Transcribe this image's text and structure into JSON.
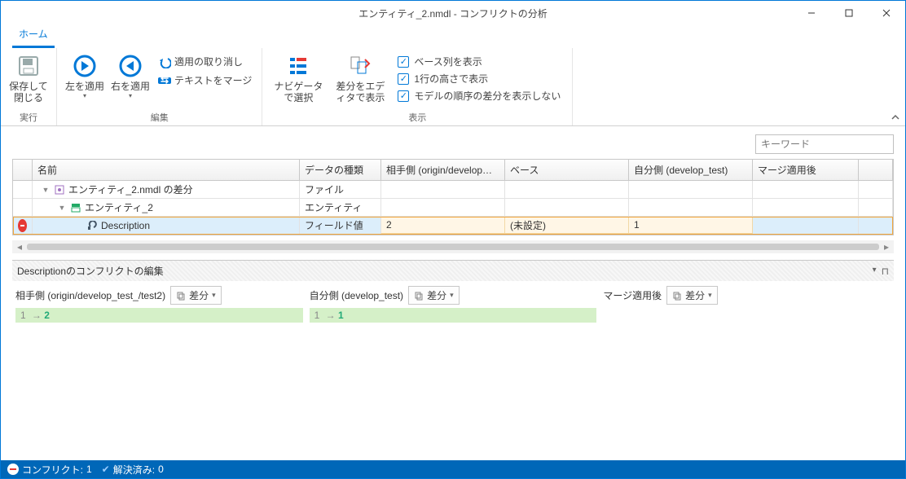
{
  "window": {
    "title": "エンティティ_2.nmdl - コンフリクトの分析"
  },
  "ribbon": {
    "tab_home": "ホーム",
    "save_close": "保存して閉じる",
    "group_exec": "実行",
    "apply_left": "左を適用",
    "apply_right": "右を適用",
    "undo_apply": "適用の取り消し",
    "merge_text": "テキストをマージ",
    "group_edit": "編集",
    "select_in_navigator": "ナビゲータで選択",
    "show_diff_in_editor": "差分をエディタで表示",
    "show_base_col": "ベース列を表示",
    "show_one_line_height": "1行の高さで表示",
    "hide_model_order_diff": "モデルの順序の差分を表示しない",
    "group_view": "表示"
  },
  "search": {
    "placeholder": "キーワード"
  },
  "grid": {
    "headers": {
      "name": "名前",
      "type": "データの種類",
      "other": "相手側 (origin/develop…",
      "base": "ベース",
      "self": "自分側 (develop_test)",
      "after": "マージ適用後"
    },
    "rows": [
      {
        "level": 1,
        "icon": "file",
        "name": "エンティティ_2.nmdl の差分",
        "type": "ファイル",
        "other": "",
        "base": "",
        "self": "",
        "after": "",
        "status": ""
      },
      {
        "level": 2,
        "icon": "entity",
        "name": "エンティティ_2",
        "type": "エンティティ",
        "other": "",
        "base": "",
        "self": "",
        "after": "",
        "status": ""
      },
      {
        "level": 3,
        "icon": "field",
        "name": "Description",
        "type": "フィールド値",
        "other": "2",
        "base": "(未設定)",
        "self": "1",
        "after": "",
        "status": "conflict"
      }
    ]
  },
  "editor": {
    "title": "Descriptionのコンフリクトの編集",
    "other_label": "相手側 (origin/develop_test_/test2)",
    "self_label": "自分側 (develop_test)",
    "after_label": "マージ適用後",
    "diff_btn": "差分",
    "other_diff_from": "1",
    "other_diff_to": "2",
    "self_diff_from": "1",
    "self_diff_to": "1"
  },
  "status": {
    "conflict_label": "コンフリクト:",
    "conflict_count": "1",
    "resolved_label": "解決済み:",
    "resolved_count": "0"
  }
}
